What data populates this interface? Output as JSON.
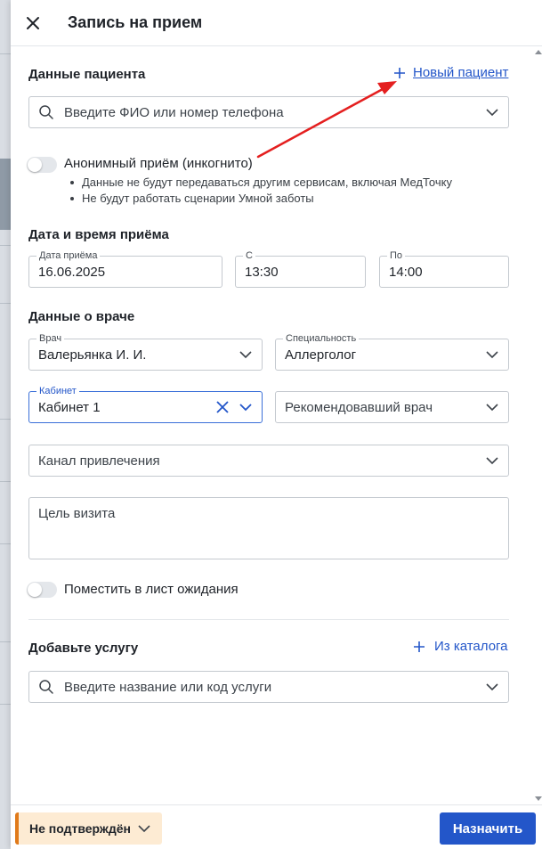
{
  "header": {
    "title": "Запись на прием",
    "close_icon": "close-icon"
  },
  "patient": {
    "section_title": "Данные пациента",
    "new_patient_link": "Новый пациент",
    "search_placeholder": "Введите ФИО или номер телефона",
    "anonymous_toggle_label": "Анонимный приём (инкогнито)",
    "anonymous_toggle_on": false,
    "notes": [
      "Данные не будут передаваться другим сервисам, включая МедТочку",
      "Не будут работать сценарии Умной заботы"
    ]
  },
  "datetime": {
    "section_title": "Дата и время приёма",
    "date_label": "Дата приёма",
    "date_value": "16.06.2025",
    "from_label": "С",
    "from_value": "13:30",
    "to_label": "По",
    "to_value": "14:00"
  },
  "doctor": {
    "section_title": "Данные о враче",
    "doctor_label": "Врач",
    "doctor_value": "Валерьянка И. И.",
    "specialty_label": "Специальность",
    "specialty_value": "Аллерголог",
    "cabinet_label": "Кабинет",
    "cabinet_value": "Кабинет 1",
    "referring_placeholder": "Рекомендовавший врач",
    "channel_placeholder": "Канал привлечения",
    "visit_goal_placeholder": "Цель визита",
    "waitlist_toggle_label": "Поместить в лист ожидания",
    "waitlist_toggle_on": false
  },
  "services": {
    "section_title": "Добавьте услугу",
    "catalog_link": "Из каталога",
    "search_placeholder": "Введите название или код услуги"
  },
  "footer": {
    "status_label": "Не подтверждён",
    "submit_label": "Назначить"
  },
  "colors": {
    "accent": "#2356c9",
    "status_bg": "#fdebd3",
    "status_bar": "#e07a1a",
    "annotation_arrow": "#e41f1f"
  }
}
